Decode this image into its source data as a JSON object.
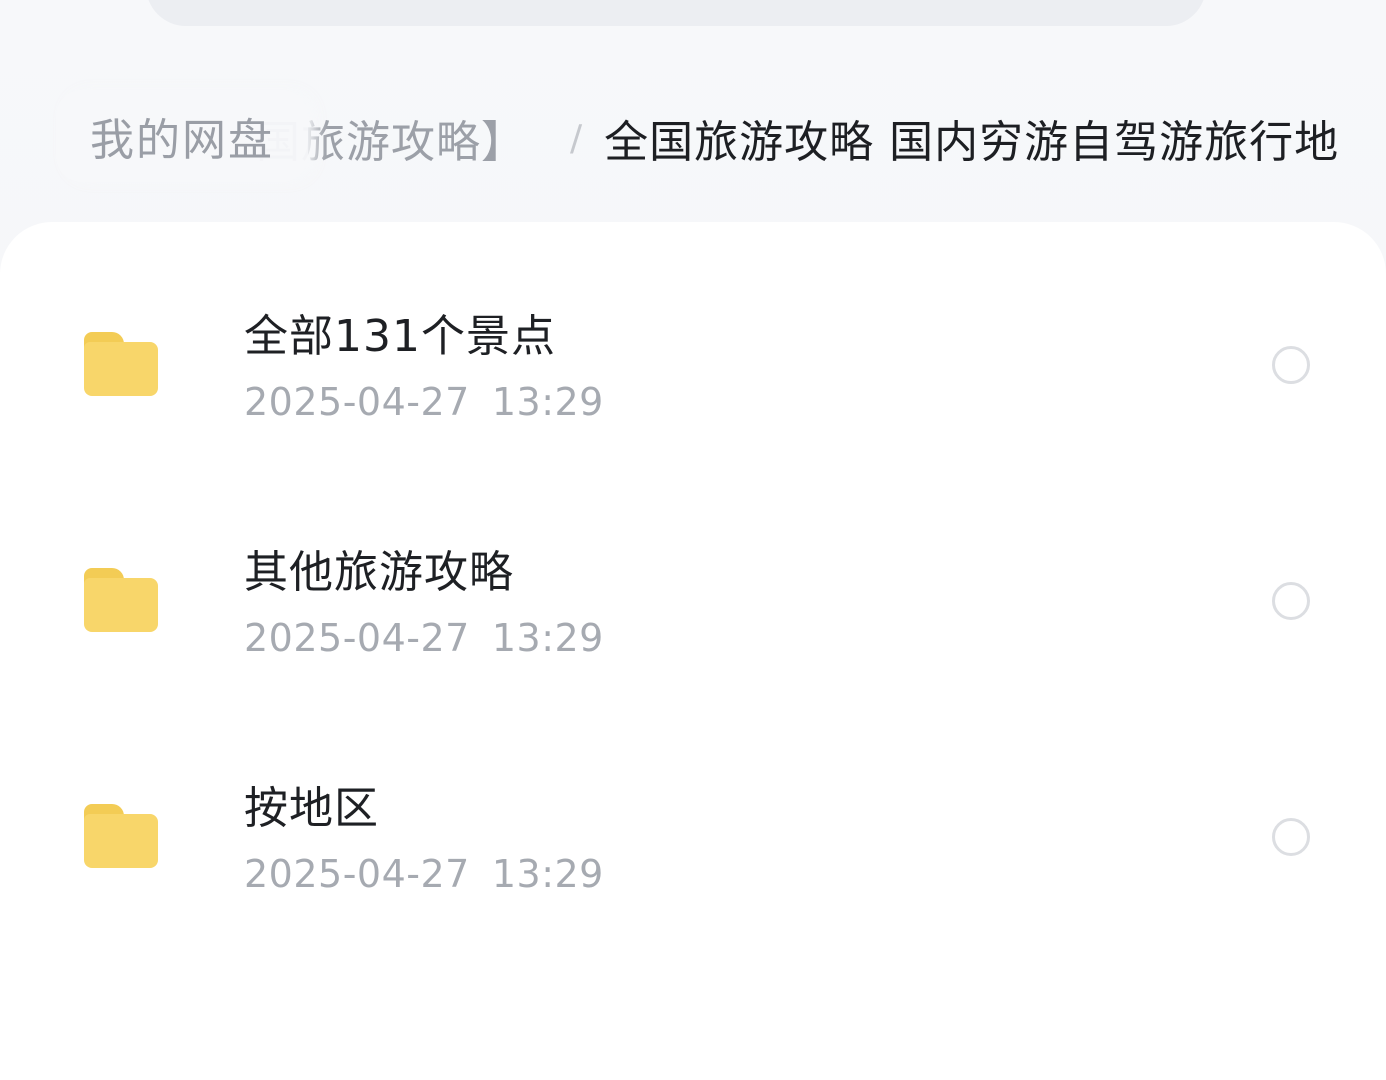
{
  "breadcrumb": {
    "root": "我的网盘",
    "middle": "国旅游攻略】",
    "separator": "/",
    "current": "全国旅游攻略 国内穷游自驾游旅行地"
  },
  "files": [
    {
      "name": "全部131个景点",
      "date": "2025-04-27",
      "time": "13:29",
      "type": "folder-icon"
    },
    {
      "name": "其他旅游攻略",
      "date": "2025-04-27",
      "time": "13:29",
      "type": "folder-icon"
    },
    {
      "name": "按地区",
      "date": "2025-04-27",
      "time": "13:29",
      "type": "folder-icon"
    }
  ],
  "colors": {
    "folder": "#f8d66a",
    "panel": "#ffffff",
    "text_primary": "#1e2024",
    "text_secondary": "#a6aab1"
  }
}
